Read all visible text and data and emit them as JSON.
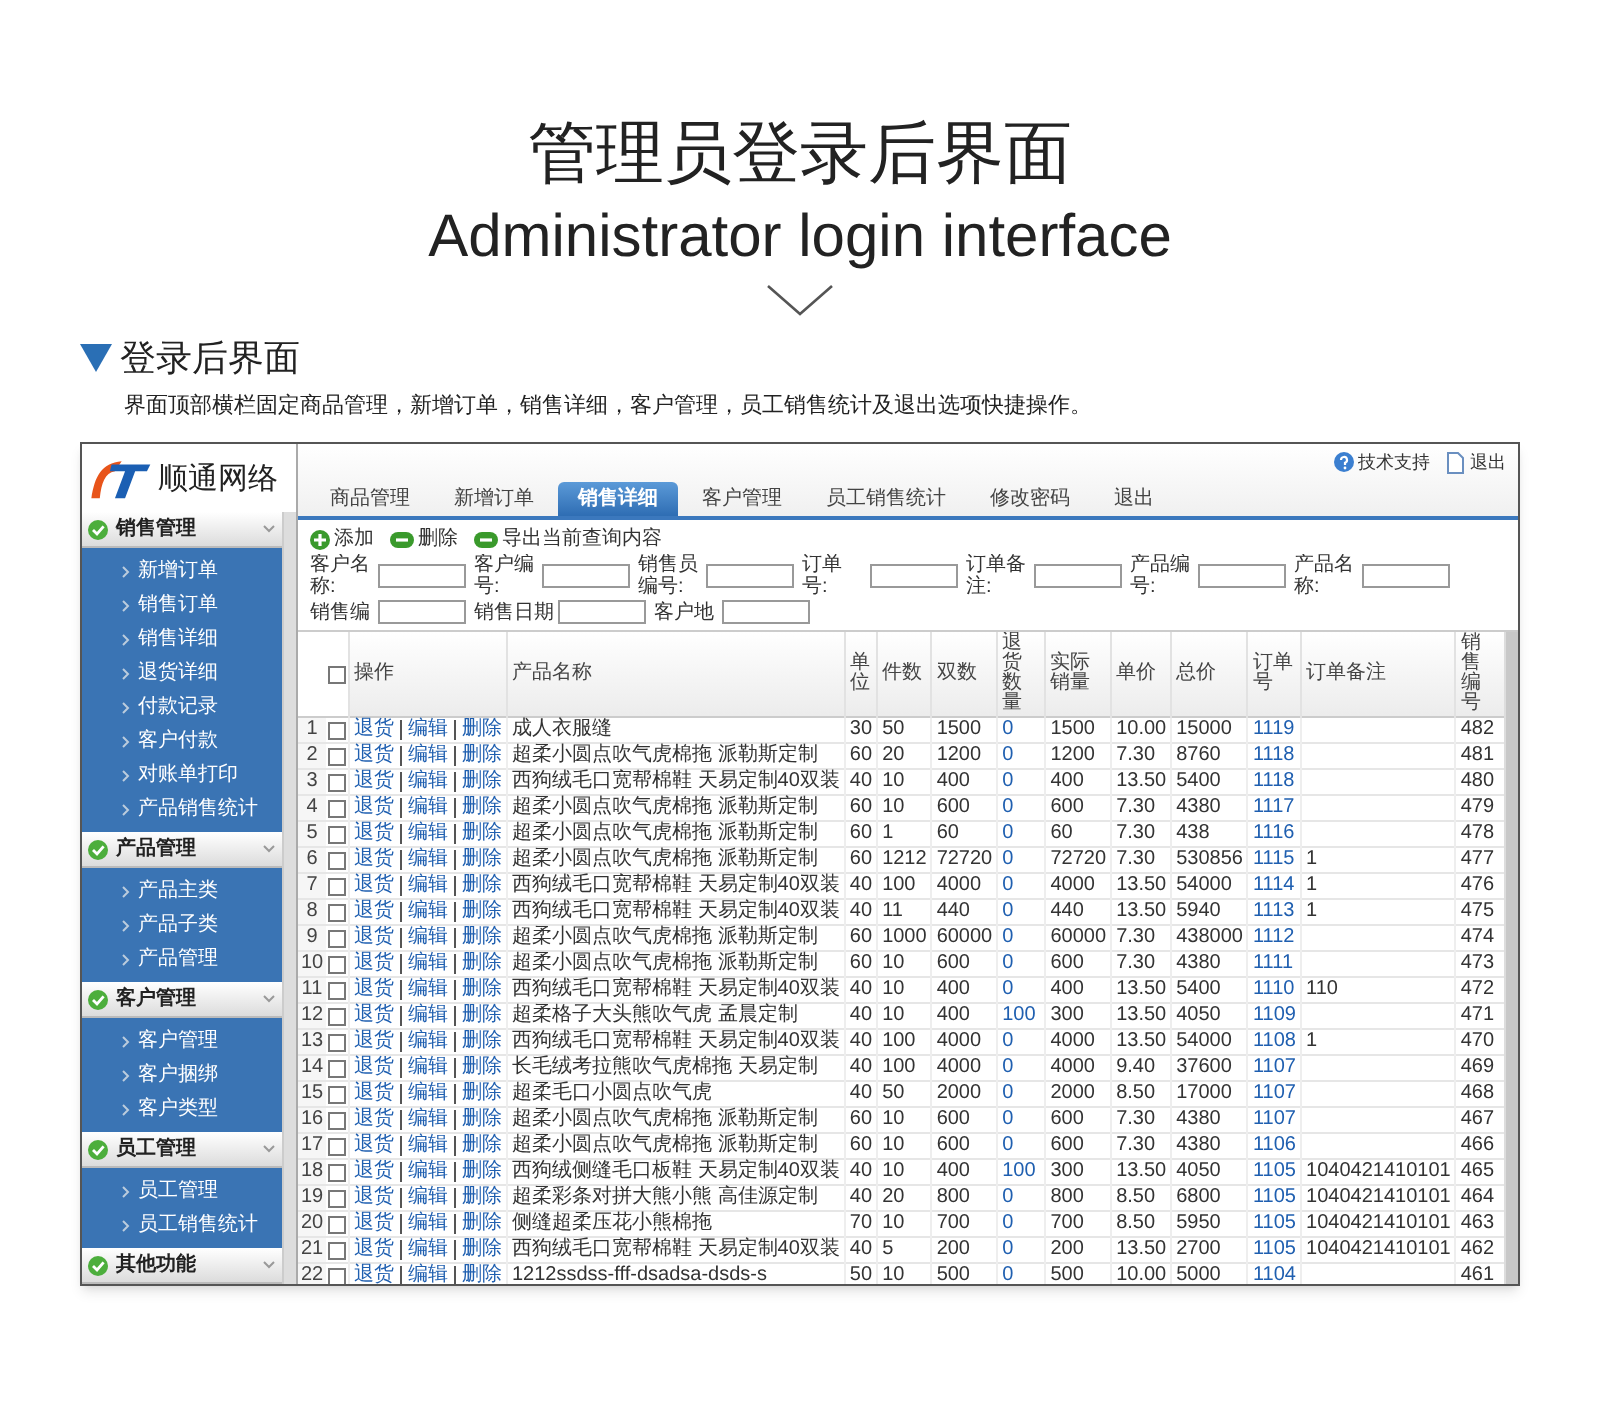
{
  "title": "管理员登录后界面",
  "subtitle": "Administrator login interface",
  "section": {
    "heading": "登录后界面",
    "description": "界面顶部横栏固定商品管理，新增订单，销售详细，客户管理，员工销售统计及退出选项快捷操作。"
  },
  "app": {
    "brand": "顺通网络",
    "top_links": [
      "技术支持",
      "退出"
    ],
    "tabs": [
      {
        "label": "商品管理",
        "selected": false
      },
      {
        "label": "新增订单",
        "selected": false
      },
      {
        "label": "销售详细",
        "selected": true
      },
      {
        "label": "客户管理",
        "selected": false
      },
      {
        "label": "员工销售统计",
        "selected": false
      },
      {
        "label": "修改密码",
        "selected": false
      },
      {
        "label": "退出",
        "selected": false
      }
    ],
    "sidebar": [
      {
        "label": "销售管理",
        "children": [
          "新增订单",
          "销售订单",
          "销售详细",
          "退货详细",
          "付款记录",
          "客户付款",
          "对账单打印",
          "产品销售统计"
        ]
      },
      {
        "label": "产品管理",
        "children": [
          "产品主类",
          "产品子类",
          "产品管理"
        ]
      },
      {
        "label": "客户管理",
        "children": [
          "客户管理",
          "客户捆绑",
          "客户类型"
        ]
      },
      {
        "label": "员工管理",
        "children": [
          "员工管理",
          "员工销售统计"
        ]
      },
      {
        "label": "其他功能"
      }
    ],
    "toolbar": [
      {
        "label": "添加",
        "kind": "add"
      },
      {
        "label": "删除",
        "kind": "remove"
      },
      {
        "label": "导出当前查询内容",
        "kind": "remove"
      }
    ],
    "filters": [
      [
        "客户名称:",
        "客户编号:",
        "销售员编号:",
        "订单号:",
        "订单备注:",
        "产品编号:",
        "产品名称:"
      ],
      [
        "销售编",
        "销售日期",
        "客户地"
      ]
    ],
    "table": {
      "header_checked": false,
      "ops_header": "操作",
      "columns": [
        {
          "label": "产品名称",
          "kind": "text"
        },
        {
          "label": "单位",
          "kind": "text"
        },
        {
          "label": "件数",
          "kind": "text"
        },
        {
          "label": "双数",
          "kind": "text"
        },
        {
          "label": "退货数量",
          "kind": "link"
        },
        {
          "label": "实际销量",
          "kind": "text"
        },
        {
          "label": "单价",
          "kind": "text"
        },
        {
          "label": "总价",
          "kind": "text"
        },
        {
          "label": "订单号",
          "kind": "link"
        },
        {
          "label": "订单备注",
          "kind": "text"
        },
        {
          "label": "销售编号",
          "kind": "text"
        }
      ],
      "rows": [
        {
          "no": "1",
          "checked": false,
          "ops": [
            "退货",
            "编辑",
            "删除"
          ],
          "cells": [
            "成人衣服缝",
            "30",
            "50",
            "1500",
            "0",
            "1500",
            "10.00",
            "15000",
            "1119",
            "",
            "482"
          ]
        },
        {
          "no": "2",
          "checked": false,
          "ops": [
            "退货",
            "编辑",
            "删除"
          ],
          "cells": [
            "超柔小圆点吹气虎棉拖 派勒斯定制",
            "60",
            "20",
            "1200",
            "0",
            "1200",
            "7.30",
            "8760",
            "1118",
            "",
            "481"
          ]
        },
        {
          "no": "3",
          "checked": false,
          "ops": [
            "退货",
            "编辑",
            "删除"
          ],
          "cells": [
            "西狗绒毛口宽帮棉鞋 天易定制40双装",
            "40",
            "10",
            "400",
            "0",
            "400",
            "13.50",
            "5400",
            "1118",
            "",
            "480"
          ]
        },
        {
          "no": "4",
          "checked": false,
          "ops": [
            "退货",
            "编辑",
            "删除"
          ],
          "cells": [
            "超柔小圆点吹气虎棉拖 派勒斯定制",
            "60",
            "10",
            "600",
            "0",
            "600",
            "7.30",
            "4380",
            "1117",
            "",
            "479"
          ]
        },
        {
          "no": "5",
          "checked": false,
          "ops": [
            "退货",
            "编辑",
            "删除"
          ],
          "cells": [
            "超柔小圆点吹气虎棉拖 派勒斯定制",
            "60",
            "1",
            "60",
            "0",
            "60",
            "7.30",
            "438",
            "1116",
            "",
            "478"
          ]
        },
        {
          "no": "6",
          "checked": false,
          "ops": [
            "退货",
            "编辑",
            "删除"
          ],
          "cells": [
            "超柔小圆点吹气虎棉拖 派勒斯定制",
            "60",
            "1212",
            "72720",
            "0",
            "72720",
            "7.30",
            "530856",
            "1115",
            "1",
            "477"
          ]
        },
        {
          "no": "7",
          "checked": false,
          "ops": [
            "退货",
            "编辑",
            "删除"
          ],
          "cells": [
            "西狗绒毛口宽帮棉鞋 天易定制40双装",
            "40",
            "100",
            "4000",
            "0",
            "4000",
            "13.50",
            "54000",
            "1114",
            "1",
            "476"
          ]
        },
        {
          "no": "8",
          "checked": false,
          "ops": [
            "退货",
            "编辑",
            "删除"
          ],
          "cells": [
            "西狗绒毛口宽帮棉鞋 天易定制40双装",
            "40",
            "11",
            "440",
            "0",
            "440",
            "13.50",
            "5940",
            "1113",
            "1",
            "475"
          ]
        },
        {
          "no": "9",
          "checked": false,
          "ops": [
            "退货",
            "编辑",
            "删除"
          ],
          "cells": [
            "超柔小圆点吹气虎棉拖 派勒斯定制",
            "60",
            "1000",
            "60000",
            "0",
            "60000",
            "7.30",
            "438000",
            "1112",
            "",
            "474"
          ]
        },
        {
          "no": "10",
          "checked": false,
          "ops": [
            "退货",
            "编辑",
            "删除"
          ],
          "cells": [
            "超柔小圆点吹气虎棉拖 派勒斯定制",
            "60",
            "10",
            "600",
            "0",
            "600",
            "7.30",
            "4380",
            "1111",
            "",
            "473"
          ]
        },
        {
          "no": "11",
          "checked": false,
          "ops": [
            "退货",
            "编辑",
            "删除"
          ],
          "cells": [
            "西狗绒毛口宽帮棉鞋 天易定制40双装",
            "40",
            "10",
            "400",
            "0",
            "400",
            "13.50",
            "5400",
            "1110",
            "110",
            "472"
          ]
        },
        {
          "no": "12",
          "checked": false,
          "ops": [
            "退货",
            "编辑",
            "删除"
          ],
          "cells": [
            "超柔格子大头熊吹气虎 孟晨定制",
            "40",
            "10",
            "400",
            "100",
            "300",
            "13.50",
            "4050",
            "1109",
            "",
            "471"
          ]
        },
        {
          "no": "13",
          "checked": false,
          "ops": [
            "退货",
            "编辑",
            "删除"
          ],
          "cells": [
            "西狗绒毛口宽帮棉鞋 天易定制40双装",
            "40",
            "100",
            "4000",
            "0",
            "4000",
            "13.50",
            "54000",
            "1108",
            "1",
            "470"
          ]
        },
        {
          "no": "14",
          "checked": false,
          "ops": [
            "退货",
            "编辑",
            "删除"
          ],
          "cells": [
            "长毛绒考拉熊吹气虎棉拖 天易定制",
            "40",
            "100",
            "4000",
            "0",
            "4000",
            "9.40",
            "37600",
            "1107",
            "",
            "469"
          ]
        },
        {
          "no": "15",
          "checked": false,
          "ops": [
            "退货",
            "编辑",
            "删除"
          ],
          "cells": [
            "超柔毛口小圆点吹气虎",
            "40",
            "50",
            "2000",
            "0",
            "2000",
            "8.50",
            "17000",
            "1107",
            "",
            "468"
          ]
        },
        {
          "no": "16",
          "checked": false,
          "ops": [
            "退货",
            "编辑",
            "删除"
          ],
          "cells": [
            "超柔小圆点吹气虎棉拖 派勒斯定制",
            "60",
            "10",
            "600",
            "0",
            "600",
            "7.30",
            "4380",
            "1107",
            "",
            "467"
          ]
        },
        {
          "no": "17",
          "checked": false,
          "ops": [
            "退货",
            "编辑",
            "删除"
          ],
          "cells": [
            "超柔小圆点吹气虎棉拖 派勒斯定制",
            "60",
            "10",
            "600",
            "0",
            "600",
            "7.30",
            "4380",
            "1106",
            "",
            "466"
          ]
        },
        {
          "no": "18",
          "checked": false,
          "ops": [
            "退货",
            "编辑",
            "删除"
          ],
          "cells": [
            "西狗绒侧缝毛口板鞋 天易定制40双装",
            "40",
            "10",
            "400",
            "100",
            "300",
            "13.50",
            "4050",
            "1105",
            "1040421410101",
            "465"
          ]
        },
        {
          "no": "19",
          "checked": false,
          "ops": [
            "退货",
            "编辑",
            "删除"
          ],
          "cells": [
            "超柔彩条对拼大熊小熊 高佳源定制",
            "40",
            "20",
            "800",
            "0",
            "800",
            "8.50",
            "6800",
            "1105",
            "1040421410101",
            "464"
          ]
        },
        {
          "no": "20",
          "checked": false,
          "ops": [
            "退货",
            "编辑",
            "删除"
          ],
          "cells": [
            "侧缝超柔压花小熊棉拖",
            "70",
            "10",
            "700",
            "0",
            "700",
            "8.50",
            "5950",
            "1105",
            "1040421410101",
            "463"
          ]
        },
        {
          "no": "21",
          "checked": false,
          "ops": [
            "退货",
            "编辑",
            "删除"
          ],
          "cells": [
            "西狗绒毛口宽帮棉鞋 天易定制40双装",
            "40",
            "5",
            "200",
            "0",
            "200",
            "13.50",
            "2700",
            "1105",
            "1040421410101",
            "462"
          ]
        },
        {
          "no": "22",
          "checked": false,
          "ops": [
            "退货",
            "编辑",
            "删除"
          ],
          "cells": [
            "1212ssdss-fff-dsadsa-dsds-s",
            "50",
            "10",
            "500",
            "0",
            "500",
            "10.00",
            "5000",
            "1104",
            "",
            "461"
          ]
        }
      ]
    }
  }
}
